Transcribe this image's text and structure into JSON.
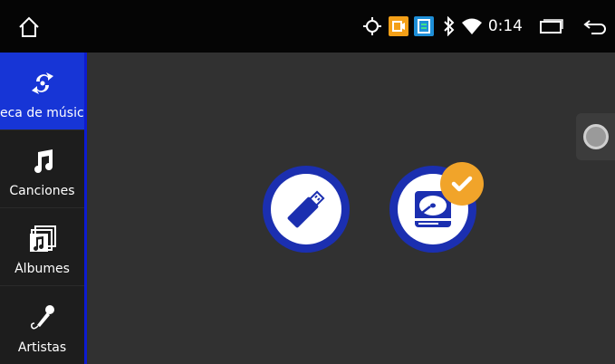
{
  "status_bar": {
    "time": "0:14",
    "icons": [
      "home-icon",
      "location-icon",
      "app-notification-icon",
      "app-notification-icon-2",
      "bluetooth-icon",
      "wifi-icon",
      "recent-apps-icon",
      "back-icon"
    ],
    "colors": {
      "notif_orange": "#f4a018",
      "notif_blue": "#1e8fd8"
    }
  },
  "sidebar": {
    "items": [
      {
        "label": "eca de músic",
        "icon": "sync-music-icon",
        "active": true
      },
      {
        "label": "Canciones",
        "icon": "music-note-icon",
        "active": false
      },
      {
        "label": "Álbumes",
        "icon": "album-icon",
        "active": false
      },
      {
        "label": "Artistas",
        "icon": "microphone-icon",
        "active": false
      }
    ],
    "active_color": "#1735d6"
  },
  "main": {
    "sources": [
      {
        "icon": "usb-icon",
        "selected": false
      },
      {
        "icon": "hard-drive-icon",
        "selected": true
      }
    ],
    "selected_badge_color": "#f1a42a"
  }
}
